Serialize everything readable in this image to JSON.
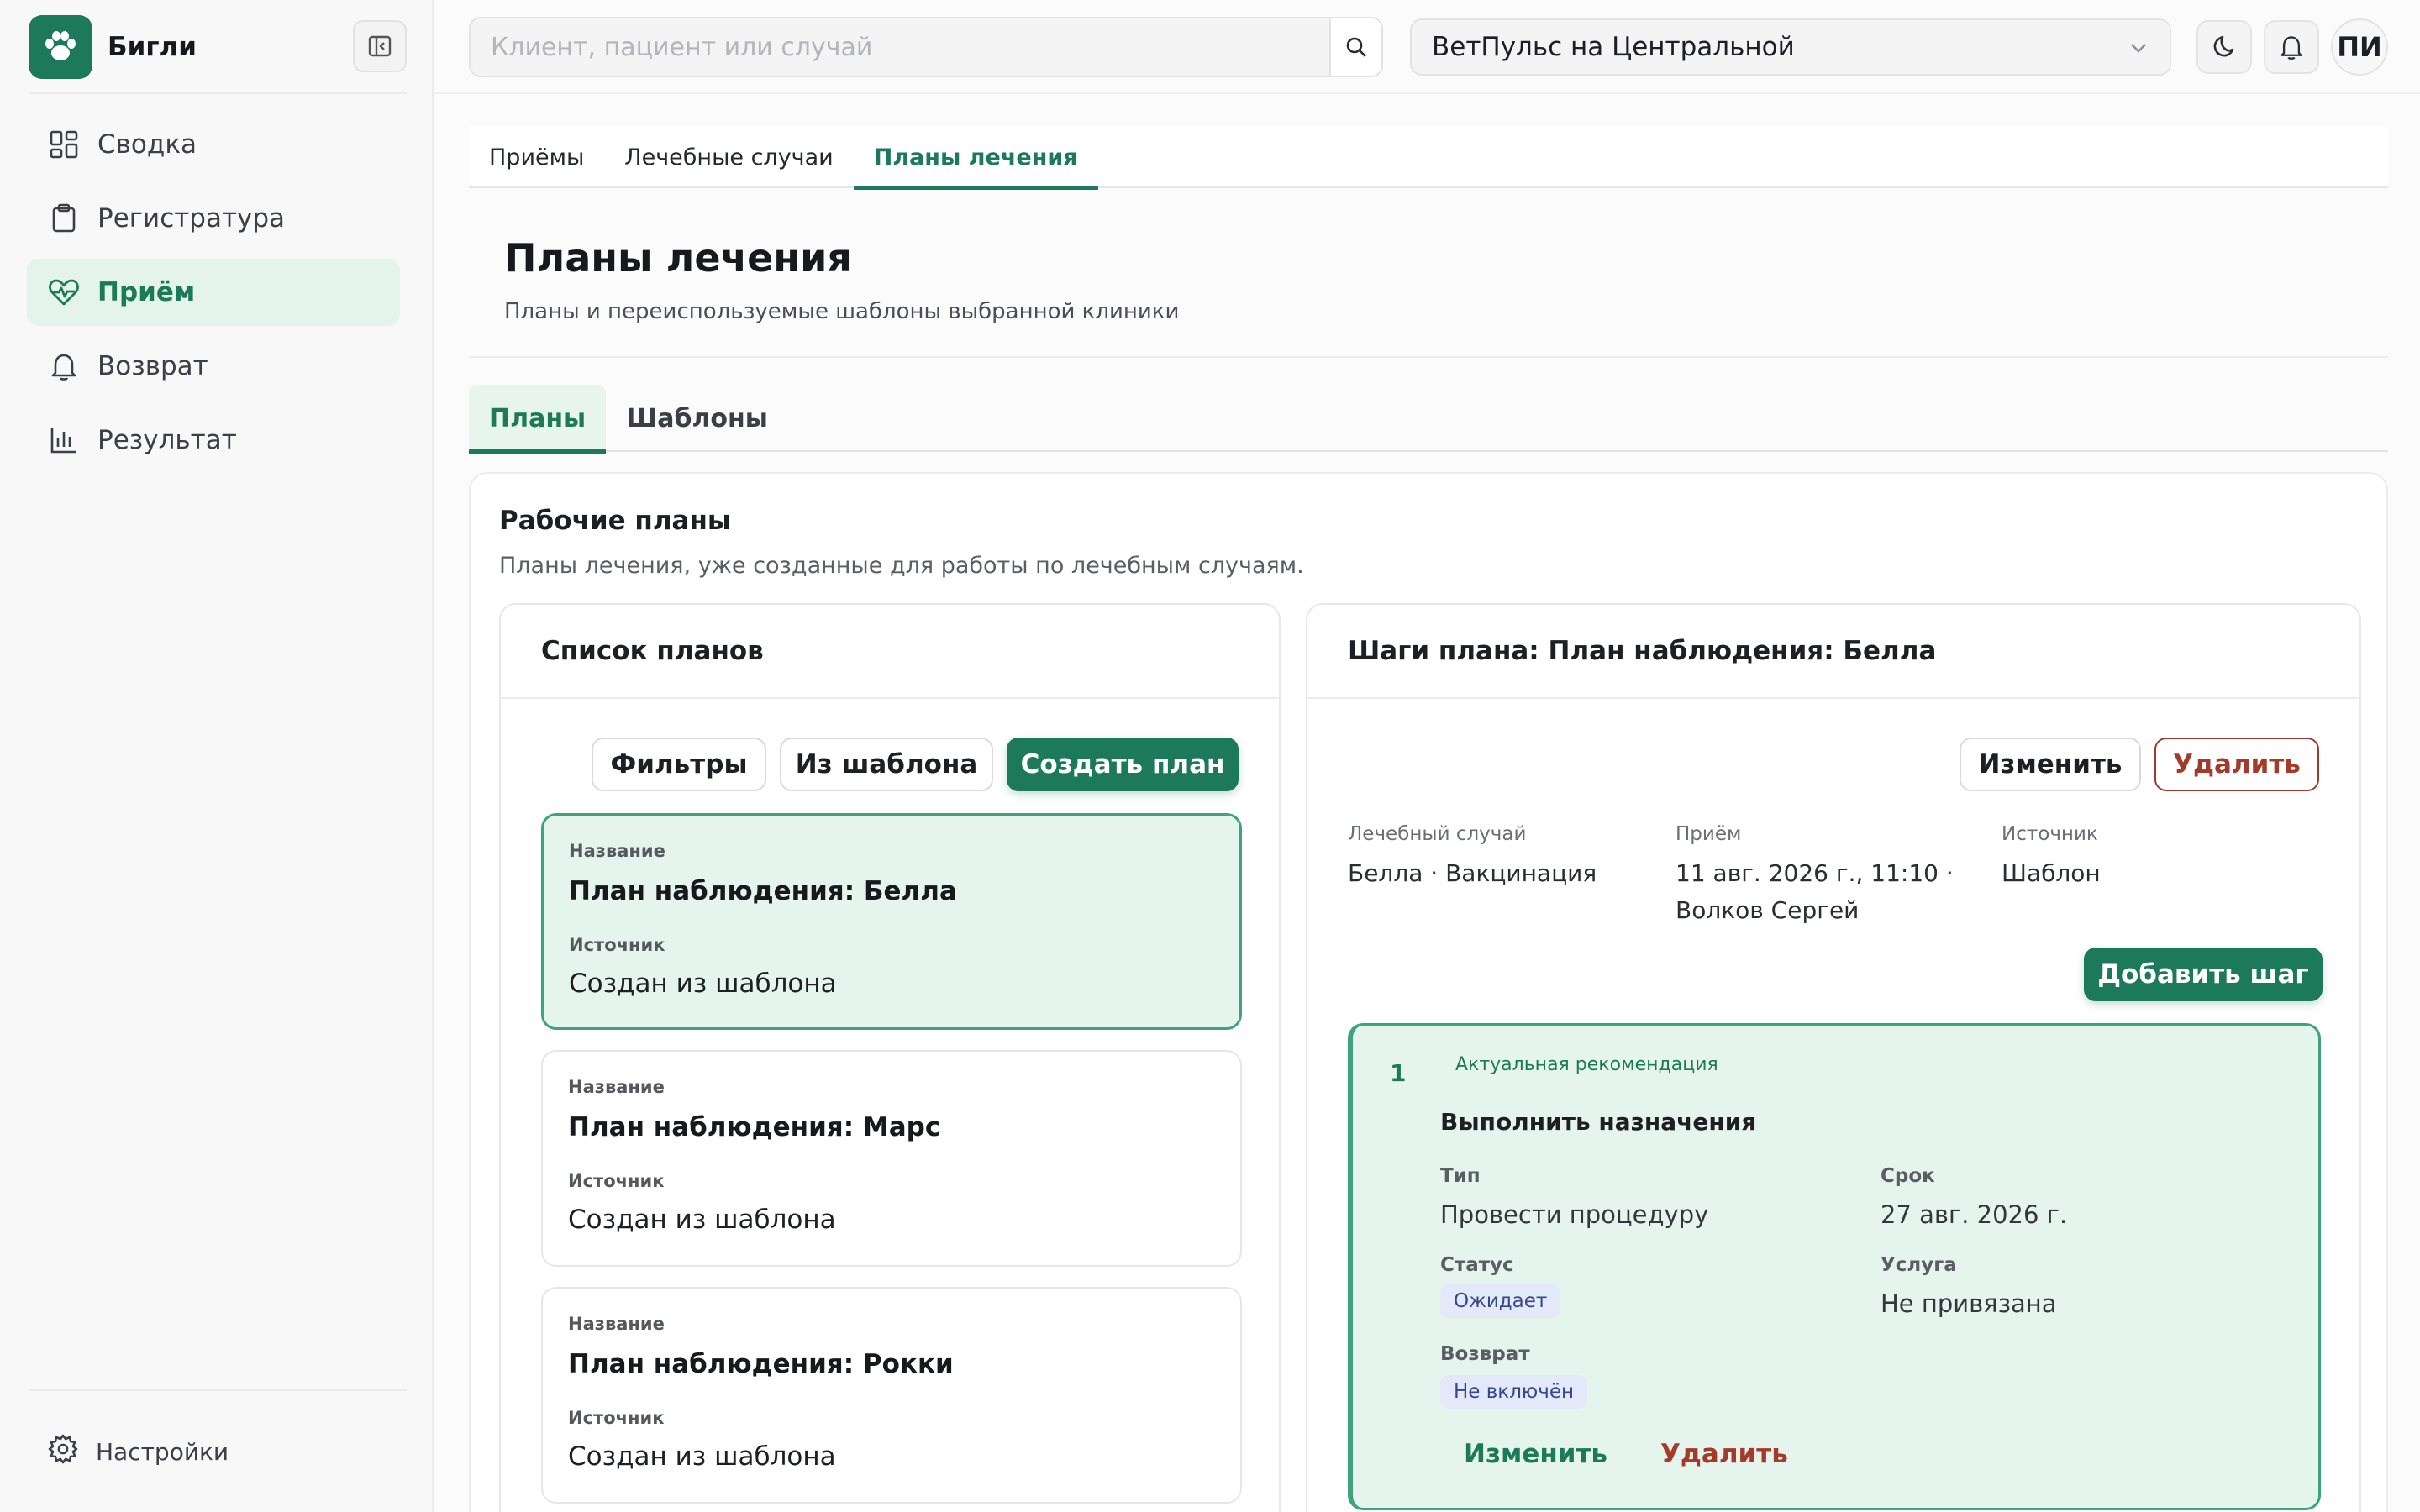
{
  "sidebar": {
    "brand": "Бигли",
    "items": [
      {
        "label": "Сводка",
        "icon": "dashboard-grid-icon"
      },
      {
        "label": "Регистратура",
        "icon": "clipboard-icon"
      },
      {
        "label": "Приём",
        "icon": "heart-pulse-icon"
      },
      {
        "label": "Возврат",
        "icon": "bell-icon"
      },
      {
        "label": "Результат",
        "icon": "bar-chart-icon"
      }
    ],
    "active_item": "Приём",
    "settings_label": "Настройки"
  },
  "topbar": {
    "search_placeholder": "Клиент, пациент или случай",
    "clinic": "ВетПульс на Центральной",
    "avatar_initials": "ПИ"
  },
  "main_tabs": [
    "Приёмы",
    "Лечебные случаи",
    "Планы лечения"
  ],
  "active_main_tab": "Планы лечения",
  "page": {
    "title": "Планы лечения",
    "subtitle": "Планы и переиспользуемые шаблоны выбранной клиники"
  },
  "sub_tabs": [
    "Планы",
    "Шаблоны"
  ],
  "active_sub_tab": "Планы",
  "work": {
    "title": "Рабочие планы",
    "subtitle": "Планы лечения, уже созданные для работы по лечебным случаям."
  },
  "list_panel": {
    "title": "Список планов",
    "buttons": {
      "filters": "Фильтры",
      "from_template": "Из шаблона",
      "create": "Создать план"
    },
    "name_label": "Название",
    "source_label": "Источник",
    "plans": [
      {
        "name": "План наблюдения: Белла",
        "source": "Создан из шаблона",
        "selected": true
      },
      {
        "name": "План наблюдения: Марс",
        "source": "Создан из шаблона",
        "selected": false
      },
      {
        "name": "План наблюдения: Рокки",
        "source": "Создан из шаблона",
        "selected": false
      }
    ]
  },
  "steps_panel": {
    "title": "Шаги плана: План наблюдения: Белла",
    "edit": "Изменить",
    "delete": "Удалить",
    "meta": {
      "case_label": "Лечебный случай",
      "case_value": "Белла · Вакцинация",
      "visit_label": "Приём",
      "visit_value_line1": "11 авг. 2026 г., 11:10 ·",
      "visit_value_line2": "Волков Сергей",
      "source_label": "Источник",
      "source_value": "Шаблон"
    },
    "add_step": "Добавить шаг",
    "step": {
      "number": "1",
      "tag": "Актуальная рекомендация",
      "title": "Выполнить назначения",
      "type_label": "Тип",
      "type_value": "Провести процедуру",
      "due_label": "Срок",
      "due_value": "27 авг. 2026 г.",
      "status_label": "Статус",
      "status_value": "Ожидает",
      "service_label": "Услуга",
      "service_value": "Не привязана",
      "return_label": "Возврат",
      "return_value": "Не включён",
      "edit": "Изменить",
      "delete": "Удалить"
    }
  },
  "colors": {
    "accent": "#1c7a5b",
    "accent_light": "#e6f4ee",
    "danger": "#a23b2a",
    "badge_bg": "#e3e9f8",
    "badge_text": "#36478a"
  }
}
